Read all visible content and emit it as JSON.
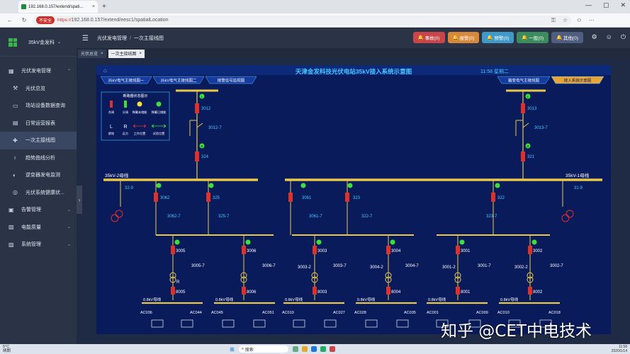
{
  "browser": {
    "tab_title": "192.168.0.157/extend/spati...",
    "tab_close": "×",
    "new_tab": "+",
    "insecure_label": "不安全",
    "url_scheme": "https://",
    "url_rest": "192.168.0.157/extend/eesc1/spatialLocation"
  },
  "sidebar": {
    "station_name": "35kV金发科",
    "items": [
      {
        "icon": "▦",
        "label": "光伏发电管理"
      },
      {
        "icon": "⚒",
        "label": "光伏总览"
      },
      {
        "icon": "▭",
        "label": "场站设备数据查询"
      },
      {
        "icon": "▤",
        "label": "日常运营报表"
      },
      {
        "icon": "✚",
        "label": "一次主接线图"
      },
      {
        "icon": "♁",
        "label": "趋势曲线分析"
      },
      {
        "icon": "◐",
        "label": "逆变器发电监测"
      },
      {
        "icon": "◎",
        "label": "光伏系统健康状..."
      },
      {
        "icon": "▣",
        "label": "告警管理"
      },
      {
        "icon": "▧",
        "label": "电能质量"
      },
      {
        "icon": "▨",
        "label": "系统管理"
      }
    ]
  },
  "topbar": {
    "menu_icon": "☰",
    "crumb1": "光伏发电管理",
    "crumb_sep": "/",
    "crumb2": "一次主接线图",
    "alarms": [
      {
        "label": "事故(0)",
        "color": "#c9454a"
      },
      {
        "label": "报警(0)",
        "color": "#d6893a"
      },
      {
        "label": "预警(0)",
        "color": "#3f9ac9"
      },
      {
        "label": "一般(0)",
        "color": "#3c8c5f"
      },
      {
        "label": "其他(0)",
        "color": "#4f5d80"
      }
    ],
    "icons": [
      "⚙",
      "☺",
      "⏻"
    ]
  },
  "page_tabs": [
    {
      "label": "光伏总览",
      "close": "×"
    },
    {
      "label": "一次主接线图",
      "close": "×"
    }
  ],
  "diagram": {
    "title": "天津金发科技光伏电站35kV接入系统示意图",
    "time": "11:58 星期二",
    "nav_left": [
      "35kV电气主接线图一",
      "35kV电气主接线图二",
      "接警信号监视图"
    ],
    "nav_right": [
      "箱变电气主接线图",
      "接入系统示意图"
    ],
    "legend": {
      "title": "断路器状态图示",
      "items": [
        "合闸",
        "分闸",
        "弹簧未储能",
        "弹簧已储能"
      ],
      "row2": [
        "就地",
        "远方",
        "工作位置",
        "试验位置"
      ],
      "L": "L",
      "R": "R"
    },
    "labels": {
      "bus2": "35kV-2母线",
      "bus1": "35kV-1母线",
      "lv_bus": "0.8kV母线"
    },
    "ids_left_col": [
      "3012",
      "3012-7",
      "324"
    ],
    "ids_right_col": [
      "3013",
      "3013-7",
      "321"
    ],
    "ids_bus2": [
      "32-9",
      "3062",
      "3062-7",
      "325",
      "325-7"
    ],
    "ids_bus1": [
      "3061",
      "3061-7",
      "323",
      "322-7",
      "322",
      "323-7",
      "31-9"
    ],
    "units": [
      {
        "top": "3005",
        "mid": "3005-7",
        "bot": "8005"
      },
      {
        "top": "3006",
        "mid": "3006-7",
        "bot": "8006"
      },
      {
        "top": "3003",
        "mid": "3003-2",
        "mid2": "3003-7",
        "bot": "8003"
      },
      {
        "top": "3004",
        "mid": "3004-2",
        "mid2": "3004-7",
        "bot": "8004"
      },
      {
        "top": "3001",
        "mid": "3001-2",
        "mid2": "3001-7",
        "bot": "8001"
      },
      {
        "top": "3002",
        "mid": "3002-2",
        "mid2": "3002-7",
        "bot": "8002"
      }
    ],
    "ac": [
      "AC036",
      "AC044",
      "AC045",
      "AC051",
      "AC019",
      "AC027",
      "AC028",
      "AC035",
      "AC001",
      "AC009",
      "AC010",
      "AC018"
    ]
  },
  "watermark": "知乎 @CET中电技术",
  "taskbar": {
    "weather_temp": "5°C",
    "weather_desc": "晴朗",
    "search": "搜索",
    "time": "11:58",
    "date": "2020/1/14"
  },
  "colors": {
    "diagram_bg": "#0a1b5c",
    "bus": "#e8c84a",
    "breaker": "#e0302a",
    "green": "#3be03b",
    "label": "#49c6ff"
  }
}
